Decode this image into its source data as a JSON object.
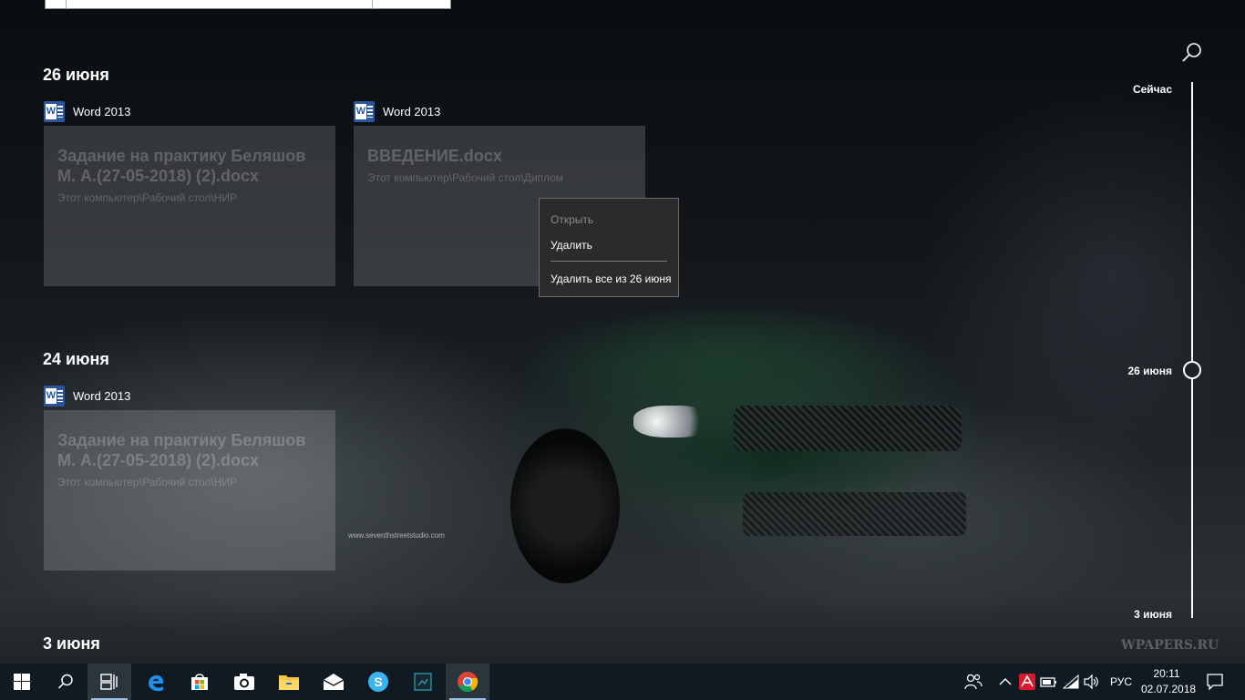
{
  "timeline": {
    "groups": [
      {
        "date": "26 июня",
        "activities": [
          {
            "app": "Word 2013",
            "title": "Задание на практику Беляшов М. А.(27-05-2018) (2).docx",
            "path": "Этот компьютер\\Рабочий стол\\НИР"
          },
          {
            "app": "Word 2013",
            "title": "ВВЕДЕНИЕ.docx",
            "path": "Этот компьютер\\Рабочий стол\\Диплом"
          }
        ]
      },
      {
        "date": "24 июня",
        "activities": [
          {
            "app": "Word 2013",
            "title": "Задание на практику Беляшов М. А.(27-05-2018) (2).docx",
            "path": "Этот компьютер\\Рабочий стол\\НИР"
          }
        ]
      },
      {
        "date": "3 июня",
        "activities": []
      }
    ],
    "scrubber": {
      "top": "Сейчас",
      "middle": "26 июня",
      "bottom": "3 июня"
    }
  },
  "context_menu": {
    "items": [
      {
        "label": "Открыть",
        "enabled": false
      },
      {
        "label": "Удалить",
        "enabled": true
      },
      {
        "label": "Удалить все из 26 июня",
        "enabled": true
      }
    ]
  },
  "wallpaper": {
    "credit": "www.seventhstreetstudio.com",
    "watermark": "WPAPERS.RU"
  },
  "taskbar": {
    "apps": [
      "start-icon",
      "search-icon",
      "task-view-icon",
      "edge-icon",
      "store-icon",
      "camera-icon",
      "file-explorer-icon",
      "mail-icon",
      "skype-icon",
      "photos-icon",
      "chrome-icon"
    ],
    "language": "РУС",
    "time": "20:11",
    "date": "02.07.2018"
  },
  "colors": {
    "word": "#2b579a",
    "taskbar": "#0f1a22",
    "accent_underline": "#9ec1e6"
  }
}
